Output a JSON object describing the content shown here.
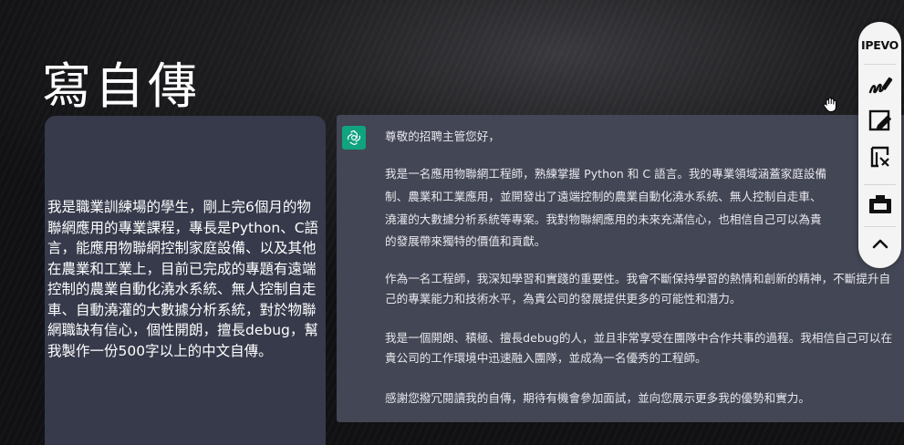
{
  "slide": {
    "title": "寫自傳"
  },
  "prompt": {
    "text": "我是職業訓練場的學生，剛上完6個月的物聯網應用的專業課程，專長是Python、C語言，能應用物聯網控制家庭設備、以及其他在農業和工業上，目前已完成的專題有遠端控制的農業自動化澆水系統、無人控制自走車、自動澆灌的大數據分析系統，對於物聯網職缺有信心，個性開朗，擅長debug，幫我製作一份500字以上的中文自傳。"
  },
  "chat": {
    "avatar_icon": "chatgpt-logo-icon",
    "greeting": "尊敬的招聘主管您好，",
    "para1_lines": [
      "我是一名應用物聯網工程師，熟練掌握 Python 和 C 語言。我的專業領域涵蓋家庭設備",
      "制、農業和工業應用，並開發出了遠端控制的農業自動化澆水系統、無人控制自走車、",
      "澆灌的大數據分析系統等專案。我對物聯網應用的未來充滿信心，也相信自己可以為貴",
      "的發展帶來獨特的價值和貢獻。"
    ],
    "para2": "作為一名工程師，我深知學習和實踐的重要性。我會不斷保持學習的熱情和創新的精神，不斷提升自己的專業能力和技術水平，為貴公司的發展提供更多的可能性和潛力。",
    "para3": "我是一個開朗、積極、擅長debug的人，並且非常享受在團隊中合作共事的過程。我相信自己可以在貴公司的工作環境中迅速融入團隊，並成為一名優秀的工程師。",
    "para4": "感謝您撥冗閱讀我的自傳，期待有機會參加面試，並向您展示更多我的優勢和實力。"
  },
  "toolbar": {
    "brand": "IPEVO",
    "tools": [
      "pen-draw-icon",
      "whiteboard-icon",
      "crop-snip-icon",
      "camera-icon",
      "chevron-up-icon"
    ]
  },
  "colors": {
    "chat_bg": "#434654",
    "prompt_bg": "#363a4b",
    "gpt_green": "#10a37f",
    "toolbar_bg": "#f4f4f4"
  }
}
